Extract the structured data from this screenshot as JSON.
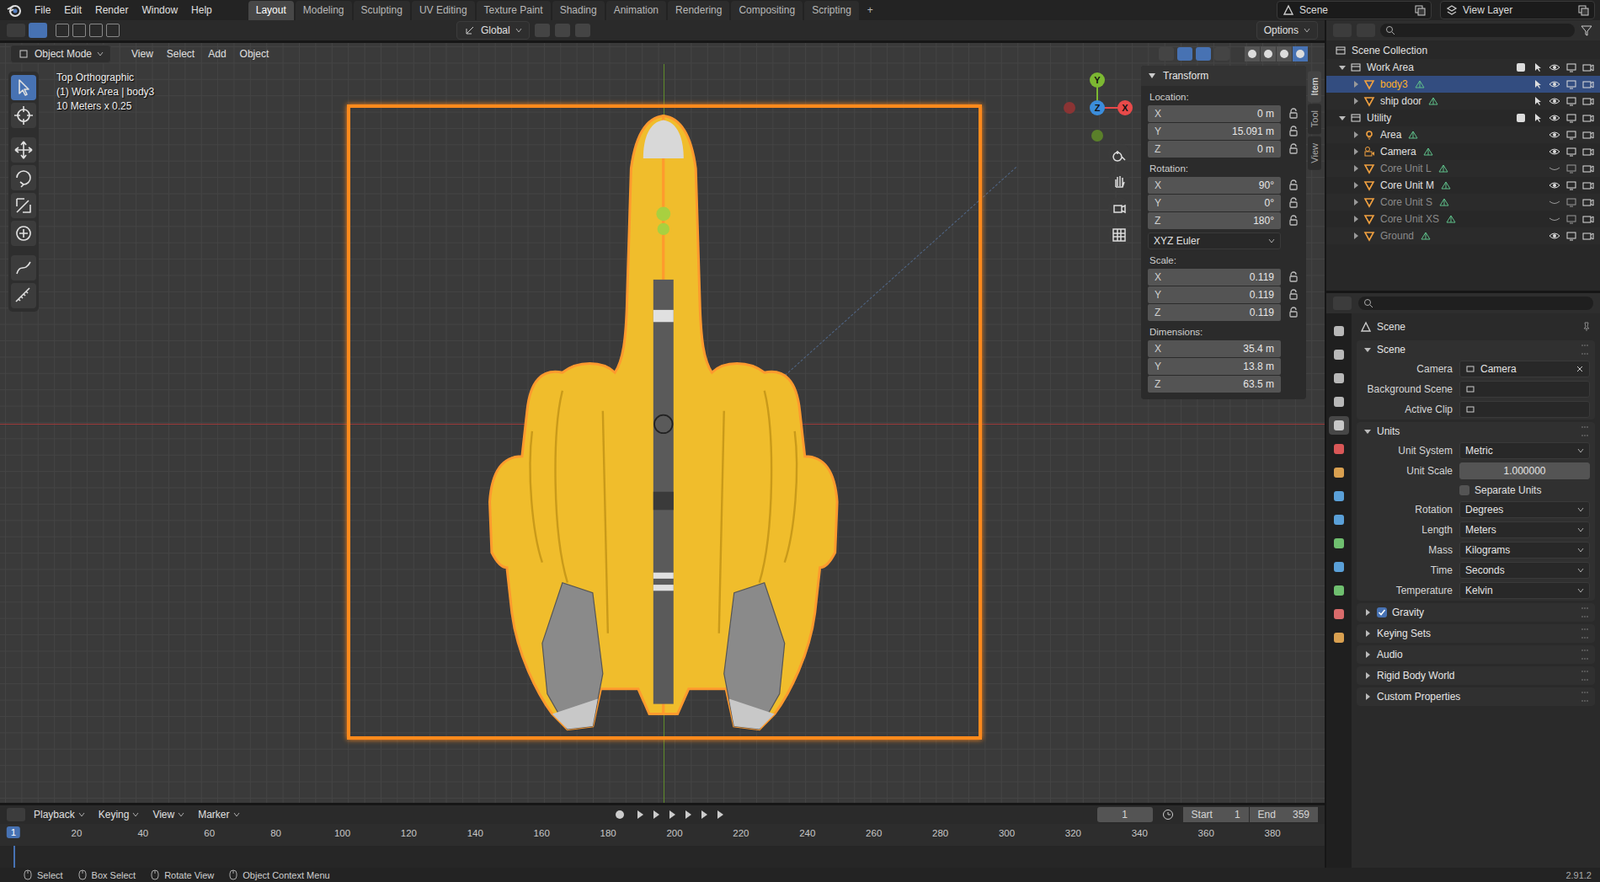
{
  "topbar": {
    "menus": [
      "File",
      "Edit",
      "Render",
      "Window",
      "Help"
    ],
    "workspaces": [
      {
        "label": "Layout",
        "selected": true
      },
      {
        "label": "Modeling",
        "selected": false
      },
      {
        "label": "Sculpting",
        "selected": false
      },
      {
        "label": "UV Editing",
        "selected": false
      },
      {
        "label": "Texture Paint",
        "selected": false
      },
      {
        "label": "Shading",
        "selected": false
      },
      {
        "label": "Animation",
        "selected": false
      },
      {
        "label": "Rendering",
        "selected": false
      },
      {
        "label": "Compositing",
        "selected": false
      },
      {
        "label": "Scripting",
        "selected": false
      }
    ],
    "add_workspace": "+",
    "scene": "Scene",
    "view_layer": "View Layer"
  },
  "tool_header": {
    "orientation": "Global",
    "options": "Options"
  },
  "toolbar": [
    {
      "selected": true
    },
    {
      "selected": false
    },
    {
      "selected": false
    },
    {
      "selected": false
    },
    {
      "selected": false
    },
    {
      "selected": false
    },
    {
      "selected": false
    },
    {
      "selected": false
    }
  ],
  "viewport": {
    "mode": "Object Mode",
    "menus": [
      "View",
      "Select",
      "Add",
      "Object"
    ],
    "info": [
      "Top Orthographic",
      "(1) Work Area | body3",
      "10 Meters x 0.25"
    ],
    "gizmo": {
      "x": "X",
      "y": "Y",
      "z": "Z"
    },
    "shading": [
      {
        "selected": false
      },
      {
        "selected": false
      },
      {
        "selected": false
      },
      {
        "selected": true
      }
    ],
    "sidebar_tabs": [
      {
        "label": "Item",
        "selected": true
      },
      {
        "label": "Tool",
        "selected": false
      },
      {
        "label": "View",
        "selected": false
      }
    ]
  },
  "transform": {
    "title": "Transform",
    "sections": [
      {
        "label": "Location:",
        "lockable": true,
        "fields": [
          {
            "axis": "X",
            "value": "0 m"
          },
          {
            "axis": "Y",
            "value": "15.091 m"
          },
          {
            "axis": "Z",
            "value": "0 m"
          }
        ]
      },
      {
        "label": "Rotation:",
        "lockable": true,
        "fields": [
          {
            "axis": "X",
            "value": "90°"
          },
          {
            "axis": "Y",
            "value": "0°"
          },
          {
            "axis": "Z",
            "value": "180°"
          }
        ],
        "mode": "XYZ Euler"
      },
      {
        "label": "Scale:",
        "lockable": true,
        "fields": [
          {
            "axis": "X",
            "value": "0.119"
          },
          {
            "axis": "Y",
            "value": "0.119"
          },
          {
            "axis": "Z",
            "value": "0.119"
          }
        ]
      },
      {
        "label": "Dimensions:",
        "lockable": false,
        "fields": [
          {
            "axis": "X",
            "value": "35.4 m"
          },
          {
            "axis": "Y",
            "value": "13.8 m"
          },
          {
            "axis": "Z",
            "value": "63.5 m"
          }
        ]
      }
    ]
  },
  "outliner": {
    "root": "Scene Collection",
    "collections": [
      {
        "name": "Work Area",
        "expanded": true,
        "included": true,
        "objects": [
          {
            "name": "body3",
            "kind": "mesh",
            "selected": true,
            "dimmed": false,
            "visible": true,
            "selectable": true
          },
          {
            "name": "ship door",
            "kind": "mesh",
            "selected": false,
            "dimmed": false,
            "visible": true,
            "selectable": true
          }
        ]
      },
      {
        "name": "Utility",
        "expanded": true,
        "included": true,
        "objects": [
          {
            "name": "Area",
            "kind": "light",
            "selected": false,
            "dimmed": false,
            "visible": true,
            "selectable": false
          },
          {
            "name": "Camera",
            "kind": "camera",
            "selected": false,
            "dimmed": false,
            "visible": true,
            "selectable": false
          },
          {
            "name": "Core Unit L",
            "kind": "mesh",
            "selected": false,
            "dimmed": true,
            "visible": false,
            "selectable": false
          },
          {
            "name": "Core Unit M",
            "kind": "mesh",
            "selected": false,
            "dimmed": false,
            "visible": true,
            "selectable": false
          },
          {
            "name": "Core Unit S",
            "kind": "mesh",
            "selected": false,
            "dimmed": true,
            "visible": false,
            "selectable": false
          },
          {
            "name": "Core Unit XS",
            "kind": "mesh",
            "selected": false,
            "dimmed": true,
            "visible": false,
            "selectable": false
          },
          {
            "name": "Ground",
            "kind": "mesh",
            "selected": false,
            "dimmed": true,
            "visible": true,
            "selectable": false
          }
        ]
      }
    ]
  },
  "properties": {
    "tabs": [
      {
        "selected": false
      },
      {
        "selected": false
      },
      {
        "selected": false
      },
      {
        "selected": false
      },
      {
        "selected": true
      },
      {
        "selected": false
      },
      {
        "selected": false
      },
      {
        "selected": false
      },
      {
        "selected": false
      },
      {
        "selected": false
      },
      {
        "selected": false
      },
      {
        "selected": false
      },
      {
        "selected": false
      },
      {
        "selected": false
      }
    ],
    "context": "Scene",
    "panels": [
      {
        "title": "Scene",
        "expanded": true,
        "rows": [
          {
            "label": "Camera",
            "kind": "object",
            "value": "Camera"
          },
          {
            "label": "Background Scene",
            "kind": "object",
            "value": ""
          },
          {
            "label": "Active Clip",
            "kind": "object",
            "value": ""
          }
        ]
      },
      {
        "title": "Units",
        "expanded": true,
        "rows": [
          {
            "label": "Unit System",
            "kind": "dropdown",
            "value": "Metric"
          },
          {
            "label": "Unit Scale",
            "kind": "number",
            "value": "1.000000"
          },
          {
            "label": "Separate Units",
            "kind": "checkbox",
            "value": "",
            "checked": false
          },
          {
            "label": "Rotation",
            "kind": "dropdown",
            "value": "Degrees"
          },
          {
            "label": "Length",
            "kind": "dropdown",
            "value": "Meters"
          },
          {
            "label": "Mass",
            "kind": "dropdown",
            "value": "Kilograms"
          },
          {
            "label": "Time",
            "kind": "dropdown",
            "value": "Seconds"
          },
          {
            "label": "Temperature",
            "kind": "dropdown",
            "value": "Kelvin"
          }
        ]
      },
      {
        "title": "Gravity",
        "expanded": false,
        "checked": true,
        "rows": []
      },
      {
        "title": "Keying Sets",
        "expanded": false,
        "rows": []
      },
      {
        "title": "Audio",
        "expanded": false,
        "rows": []
      },
      {
        "title": "Rigid Body World",
        "expanded": false,
        "rows": []
      },
      {
        "title": "Custom Properties",
        "expanded": false,
        "rows": []
      }
    ]
  },
  "timeline": {
    "menus": [
      "Playback",
      "Keying",
      "View",
      "Marker"
    ],
    "current_frame": "1",
    "start_label": "Start",
    "start": "1",
    "end_label": "End",
    "end": "359",
    "ticks": [
      "20",
      "40",
      "60",
      "80",
      "100",
      "120",
      "140",
      "160",
      "180",
      "200",
      "220",
      "240",
      "260",
      "280",
      "300",
      "320",
      "340",
      "360",
      "380"
    ]
  },
  "status_bar": {
    "items": [
      "Select",
      "Box Select",
      "Rotate View",
      "Object Context Menu"
    ],
    "version": "2.91.2"
  }
}
